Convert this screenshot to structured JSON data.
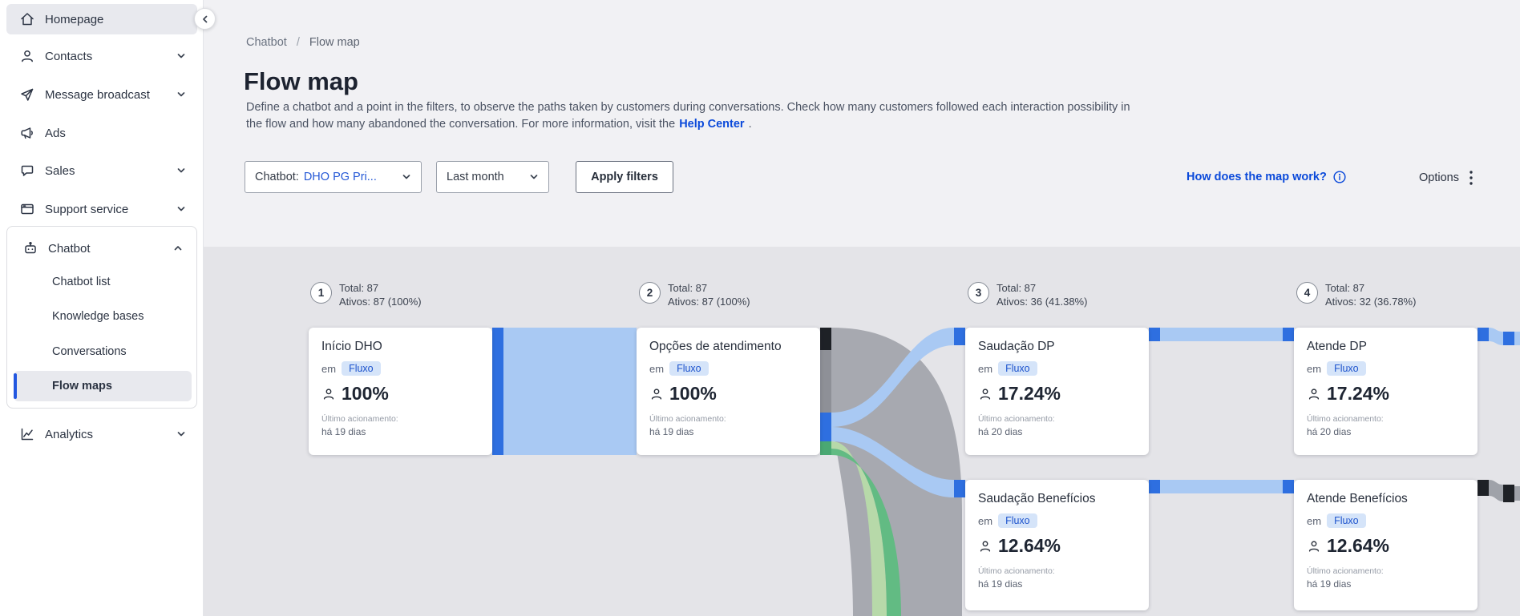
{
  "sidebar": {
    "items": [
      {
        "label": "Homepage",
        "icon": "home-icon",
        "selected": true
      },
      {
        "label": "Contacts",
        "icon": "contacts-icon"
      },
      {
        "label": "Message broadcast",
        "icon": "send-icon"
      },
      {
        "label": "Ads",
        "icon": "ads-icon"
      },
      {
        "label": "Sales",
        "icon": "sales-icon"
      },
      {
        "label": "Support service",
        "icon": "support-icon"
      },
      {
        "label": "Chatbot",
        "icon": "chatbot-icon",
        "expanded": true
      },
      {
        "label": "Analytics",
        "icon": "analytics-icon"
      }
    ],
    "chatbot_submenu": [
      {
        "label": "Chatbot list"
      },
      {
        "label": "Knowledge bases"
      },
      {
        "label": "Conversations"
      },
      {
        "label": "Flow maps",
        "selected": true
      }
    ]
  },
  "breadcrumb": {
    "parent": "Chatbot",
    "separator": "/",
    "current": "Flow map"
  },
  "header": {
    "title": "Flow map",
    "description_before": "Define a chatbot and a point in the filters, to observe the paths taken by customers during conversations. Check how many customers followed each interaction possibility in the flow and how many abandoned the conversation. For more information, visit the",
    "help_link": "Help Center",
    "description_after": "."
  },
  "filters": {
    "chatbot_label": "Chatbot:",
    "chatbot_value": "DHO PG Pri...",
    "period_value": "Last month",
    "apply_label": "Apply filters",
    "map_help_label": "How does the map work?",
    "options_label": "Options"
  },
  "flow": {
    "columns": [
      {
        "number": "1",
        "total": "Total: 87",
        "actives": "Ativos: 87 (100%)"
      },
      {
        "number": "2",
        "total": "Total: 87",
        "actives": "Ativos: 87 (100%)"
      },
      {
        "number": "3",
        "total": "Total: 87",
        "actives": "Ativos: 36 (41.38%)"
      },
      {
        "number": "4",
        "total": "Total: 87",
        "actives": "Ativos: 32 (36.78%)"
      }
    ],
    "cards": [
      {
        "title": "Início DHO",
        "em_label": "em",
        "badge": "Fluxo",
        "percent": "100%",
        "last_label": "Último acionamento:",
        "last_value": "há 19 dias"
      },
      {
        "title": "Opções de atendimento",
        "em_label": "em",
        "badge": "Fluxo",
        "percent": "100%",
        "last_label": "Último acionamento:",
        "last_value": "há 19 dias"
      },
      {
        "title": "Saudação DP",
        "em_label": "em",
        "badge": "Fluxo",
        "percent": "17.24%",
        "last_label": "Último acionamento:",
        "last_value": "há 20 dias"
      },
      {
        "title": "Atende DP",
        "em_label": "em",
        "badge": "Fluxo",
        "percent": "17.24%",
        "last_label": "Último acionamento:",
        "last_value": "há 20 dias"
      },
      {
        "title": "Saudação Benefícios",
        "em_label": "em",
        "badge": "Fluxo",
        "percent": "12.64%",
        "last_label": "Último acionamento:",
        "last_value": "há 19 dias"
      },
      {
        "title": "Atende Benefícios",
        "em_label": "em",
        "badge": "Fluxo",
        "percent": "12.64%",
        "last_label": "Último acionamento:",
        "last_value": "há 19 dias"
      }
    ]
  },
  "colors": {
    "accent_blue": "#0a49da",
    "node_blue": "#2e6fe0",
    "band_light_blue": "#a9c9f3",
    "band_gray": "#a7a9b0",
    "band_green": "#62bb83",
    "band_light_green": "#b7d9a9",
    "node_black": "#1e2126",
    "badge_bg": "#d5e4f9",
    "selected_item_bg": "#e8e9ee"
  }
}
